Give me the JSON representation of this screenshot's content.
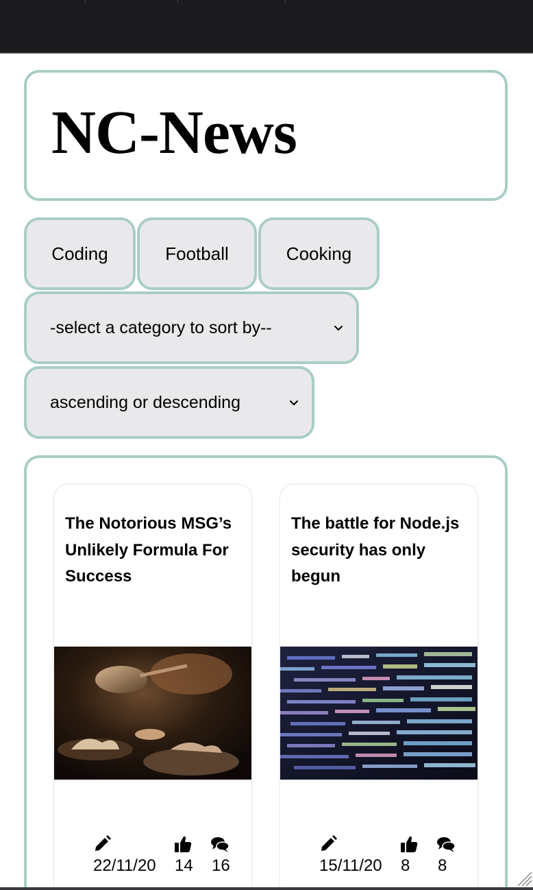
{
  "header": {
    "title": "NC-News"
  },
  "topics": [
    {
      "label": "Coding"
    },
    {
      "label": "Football"
    },
    {
      "label": "Cooking"
    }
  ],
  "sort_select": {
    "selected": "-select a category to sort by--"
  },
  "order_select": {
    "selected": "ascending or descending"
  },
  "articles": [
    {
      "title": "The Notorious MSG’s Unlikely Formula For Success",
      "image": "cooking-photo",
      "date": "22/11/20",
      "votes": "14",
      "comments": "16"
    },
    {
      "title": "The battle for Node.js security has only begun",
      "image": "code-screen-photo",
      "date": "15/11/20",
      "votes": "8",
      "comments": "8"
    }
  ],
  "icons": {
    "author": "pencil-icon",
    "votes": "thumbs-up-icon",
    "comments": "comments-icon",
    "select": "chevron-down-icon"
  },
  "colors": {
    "accent_border": "#a9cdc6",
    "button_bg": "#e9e9ec",
    "topbar": "#1b1b1d"
  }
}
